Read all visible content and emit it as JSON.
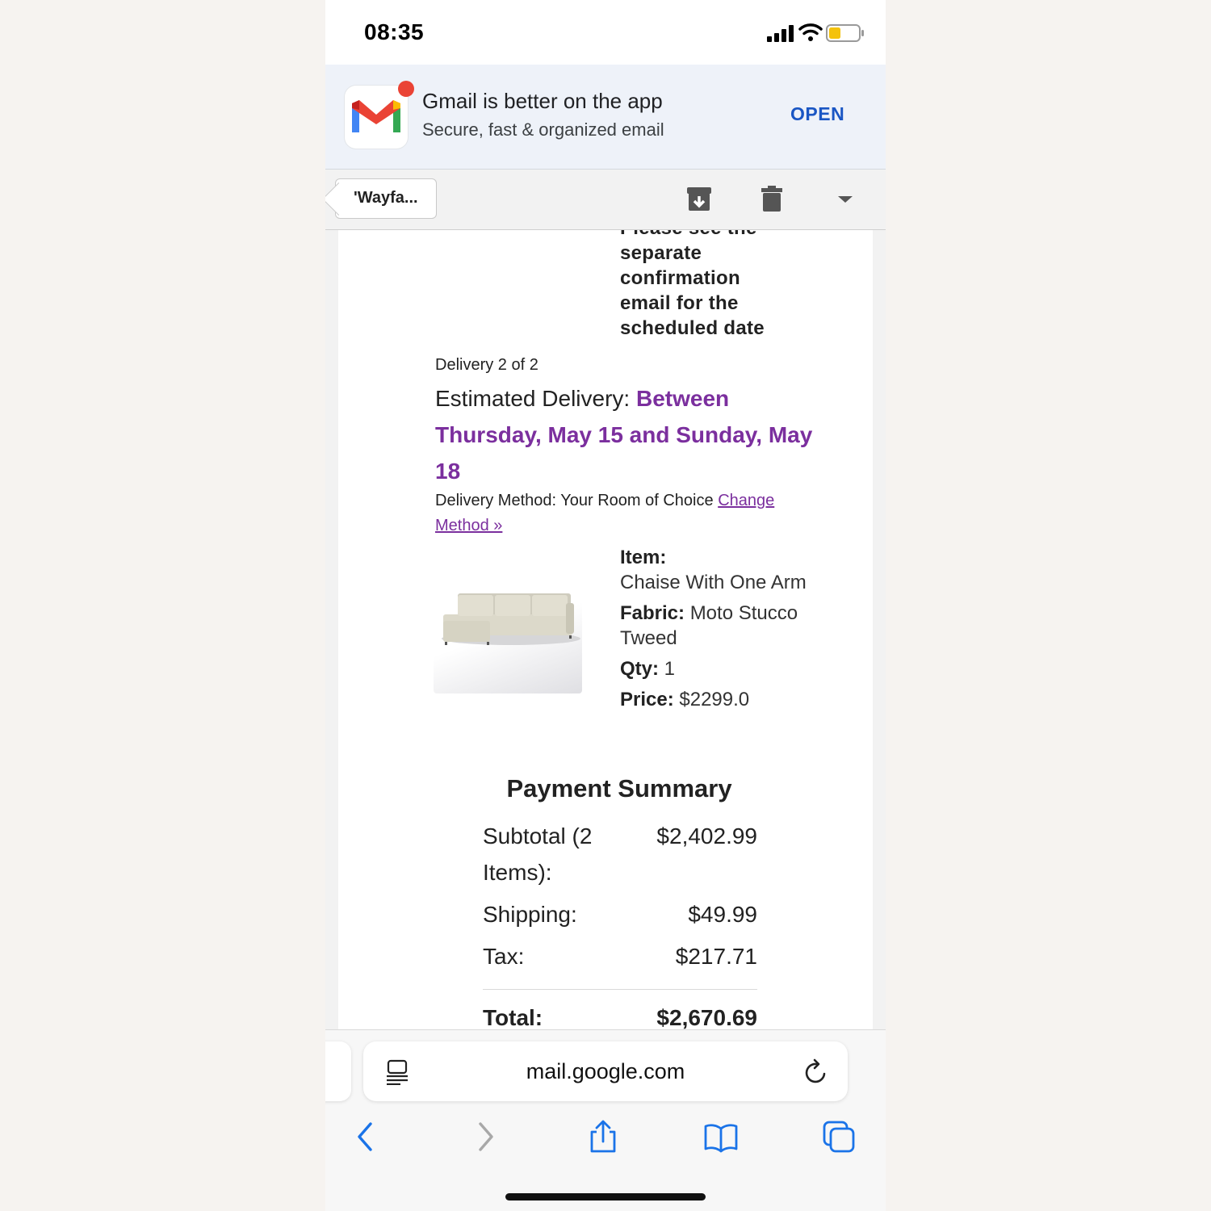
{
  "status_bar": {
    "time": "08:35"
  },
  "banner": {
    "title": "Gmail is better on the app",
    "subtitle": "Secure, fast & organized email",
    "open_label": "OPEN"
  },
  "toolbar": {
    "back_label": "'Wayfa..."
  },
  "email": {
    "note_cutoff": "Please see the",
    "note_lines": [
      "separate",
      "confirmation",
      "email for the",
      "scheduled date"
    ],
    "delivery_count": "Delivery 2 of 2",
    "estimated_label": "Estimated Delivery:",
    "estimated_value": "Between Thursday, May 15 and Sunday, May 18",
    "method_label": "Delivery Method: Your Room of Choice",
    "change_method_link": "Change Method »",
    "item": {
      "item_label": "Item:",
      "item_value": "Chaise With One Arm",
      "fabric_label": "Fabric:",
      "fabric_value": "Moto Stucco Tweed",
      "qty_label": "Qty:",
      "qty_value": "1",
      "price_label": "Price:",
      "price_value": "$2299.0"
    },
    "payment": {
      "title": "Payment Summary",
      "rows": [
        {
          "label": "Subtotal (2 Items):",
          "value": "$2,402.99"
        },
        {
          "label": "Shipping:",
          "value": "$49.99"
        },
        {
          "label": "Tax:",
          "value": "$217.71"
        }
      ],
      "total_label": "Total:",
      "total_value": "$2,670.69"
    }
  },
  "safari": {
    "url": "mail.google.com"
  },
  "colors": {
    "accent_purple": "#7b2f9e",
    "open_blue": "#1a56c4",
    "safari_blue": "#1a73e8"
  }
}
